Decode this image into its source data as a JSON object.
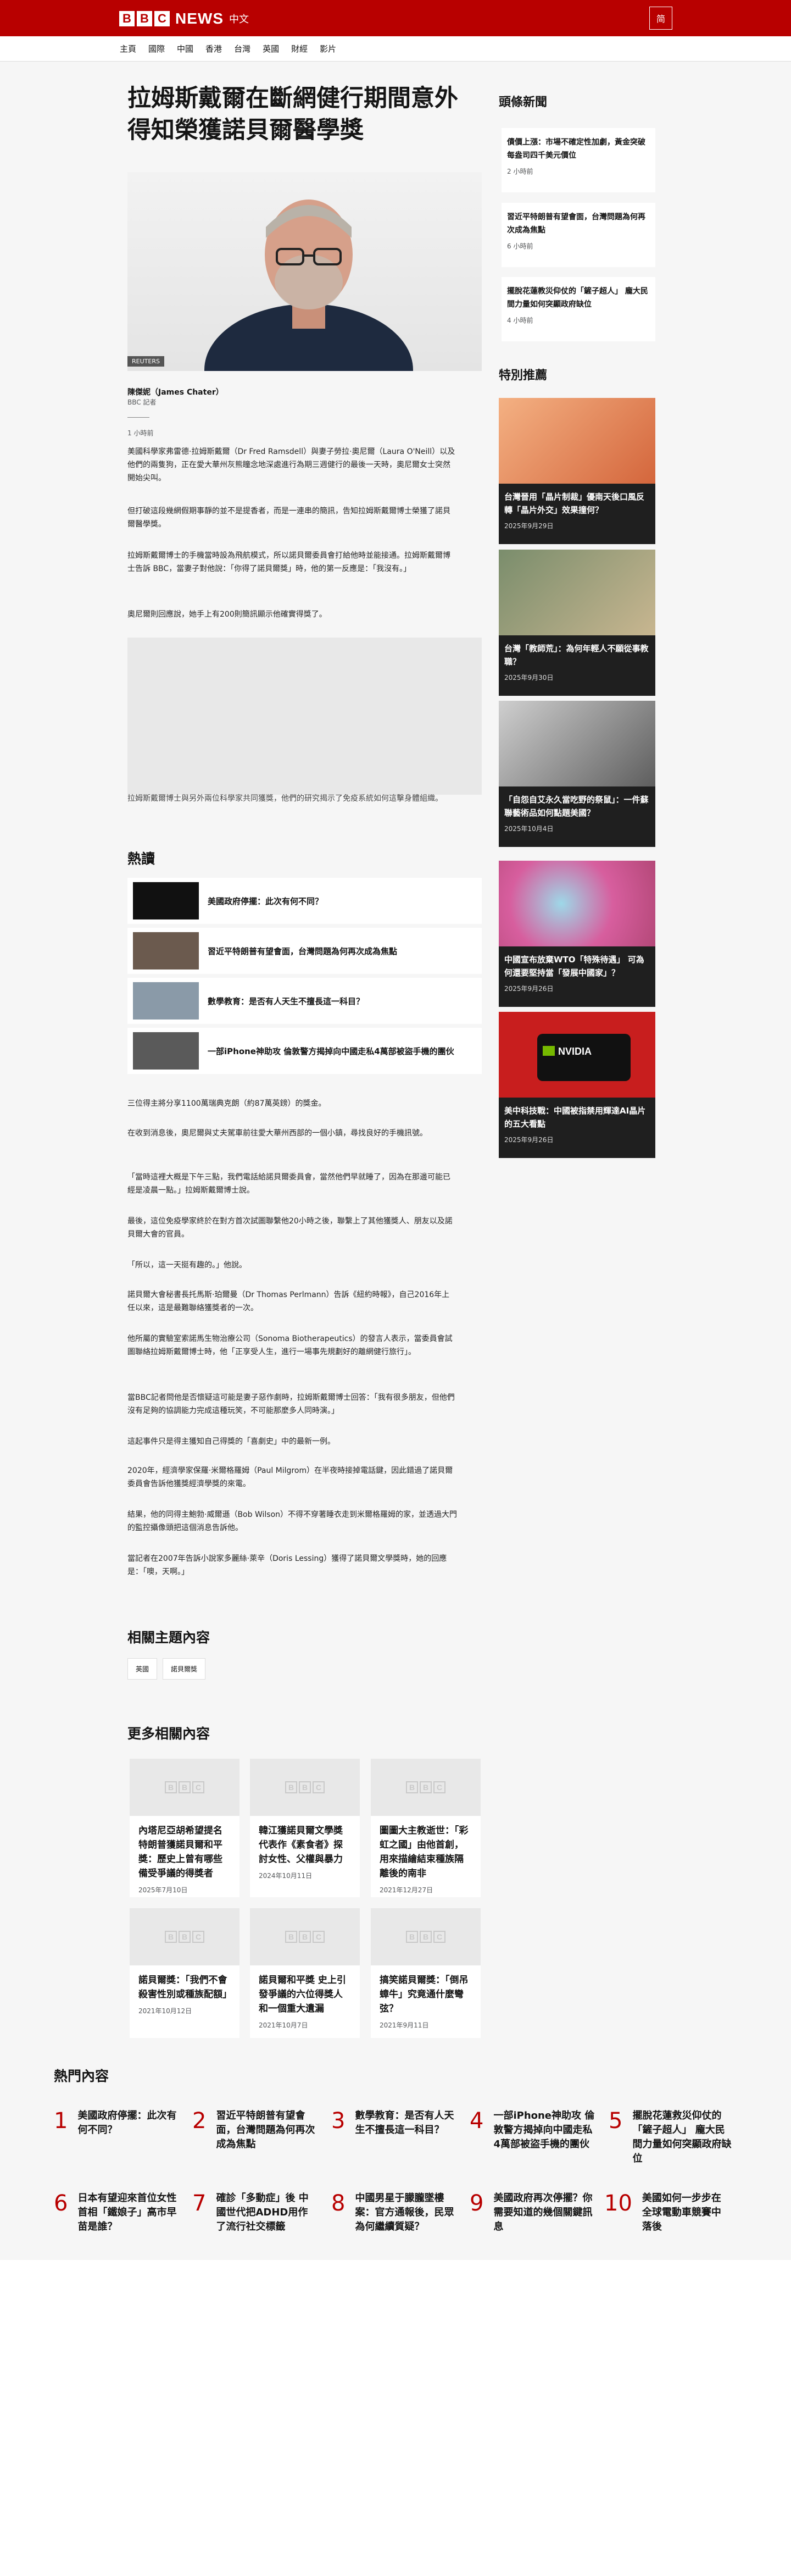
{
  "header": {
    "brand_blocks": [
      "B",
      "B",
      "C"
    ],
    "brand_news": "NEWS",
    "brand_lang": "中文",
    "menu_button": "简"
  },
  "nav": [
    "主頁",
    "國際",
    "中國",
    "香港",
    "台灣",
    "英國",
    "財經",
    "影片"
  ],
  "article": {
    "title": "拉姆斯戴爾在斷網健行期間意外得知榮獲諾貝爾醫學獎",
    "image_credit": "REUTERS",
    "author": "陳傑妮（James Chater）",
    "author_role": "BBC 記者",
    "time": "1 小時前",
    "paragraphs": [
      "美國科學家弗雷德·拉姆斯戴爾（Dr Fred Ramsdell）與妻子勞拉·奧尼爾（Laura O'Neill）以及他們的兩隻狗，正在愛大華州灰熊瞳念地深處進行為期三週健行的最後一天時，奧尼爾女士突然開始尖叫。",
      "但打破這段幾網假期事靜的並不是提香者，而是一連串的簡訊，告知拉姆斯戴爾博士榮獲了諾貝爾醫學獎。",
      "拉姆斯戴爾博士的手機當時設為飛航模式，所以諾貝爾委員會打給他時並能接通。拉姆斯戴爾博士告訴 BBC，當妻子對他說：「你得了諾貝爾獎」時，他的第一反應是：「我沒有。」",
      "奧尼爾則回應說，她手上有200則簡訊顯示他確實得獎了。"
    ],
    "photo_caption": "拉姆斯戴爾博士與另外兩位科學家共同獲獎，他們的研究揭示了免疫系統如何這擊身體組織。",
    "paragraphs2": [
      "三位得主將分享1100萬瑞典克朗（約87萬英鎊）的獎金。",
      "在收到消息後，奧尼爾與丈夫駕車前往愛大華州西部的一個小鎮，尋找良好的手機訊號。",
      "「當時這裡大概是下午三點，我們電話給諾貝爾委員會，當然他們早就睡了，因為在那邊可能已經是凌晨一點。」拉姆斯戴爾博士說。",
      "最後，這位免疫學家終於在對方首次試圖聯繫他20小時之後，聯繫上了其他獲獎人、朋友以及諾貝爾大會的官員。",
      "「所以，這一天挺有趣的。」他說。",
      "諾貝爾大會秘書長托馬斯·珀爾曼（Dr Thomas Perlmann）告訴《紐約時報》，自己2016年上任以來，這是最難聯絡獲獎者的一次。",
      "他所屬的實驗室索諾馬生物治療公司（Sonoma Biotherapeutics）的發言人表示，當委員會試圖聯絡拉姆斯戴爾博士時，他「正享受人生，進行一場事先規劃好的離網健行旅行」。",
      "當BBC記者問他是否懷疑這可能是妻子惡作劇時，拉姆斯戴爾博士回答：「我有很多朋友，但他們沒有足夠的協調能力完成這種玩笑，不可能那麼多人同時演。」",
      "這起事件只是得主獲知自己得獎的「喜劇史」中的最新一例。",
      "2020年，經濟學家保羅·米爾格羅姆（Paul Milgrom）在半夜時接掉電話鍵，因此錯過了諾貝爾委員會告訴他獲獎經濟學獎的來電。",
      "結果，他的同得主鮑勃·威爾遜（Bob Wilson）不得不穿著睡衣走到米爾格羅姆的家，並透過大門的監控攝像頭把這個消息告訴他。",
      "當記者在2007年告訴小說家多麗絲·萊辛（Doris Lessing）獲得了諾貝爾文學獎時，她的回應是：「噢，天啊。」"
    ]
  },
  "hot_section": {
    "title": "熱讀",
    "items": [
      "美國政府停擺：此次有何不同？",
      "習近平特朗普有望會面，台灣問題為何再次成為焦點",
      "數學教育：是否有人天生不擅長這一科目？",
      "一部iPhone神助攻 倫敦警方揭掉向中國走私4萬部被盜手機的團伙"
    ]
  },
  "related_topics": {
    "title": "相關主題內容",
    "tags": [
      "英國",
      "諾貝爾獎"
    ]
  },
  "more_related": {
    "title": "更多相關內容",
    "cards": [
      {
        "title": "內塔尼亞胡希望提名特朗普獲諾貝爾和平獎：歷史上曾有哪些備受爭議的得獎者",
        "date": "2025年7月10日"
      },
      {
        "title": "韓江獲諾貝爾文學獎 代表作《素食者》探討女性、父權與暴力",
        "date": "2024年10月11日"
      },
      {
        "title": "圖圖大主教逝世：「彩虹之國」由他首創，用來描繪結束種族隔離後的南非",
        "date": "2021年12月27日"
      },
      {
        "title": "諾貝爾獎：「我們不會殺害性別或種族配額」",
        "date": "2021年10月12日"
      },
      {
        "title": "諾貝爾和平獎 史上引發爭議的六位得獎人和一個重大遺漏",
        "date": "2021年10月7日"
      },
      {
        "title": "搞笑諾貝爾獎：「倒吊蟑牛」究竟通什麼彎弦？",
        "date": "2021年9月11日"
      }
    ]
  },
  "sidebar": {
    "headlines_title": "頭條新聞",
    "headlines": [
      {
        "title": "債價上漲：市場不確定性加劇，黃金突破每盎司四千美元價位",
        "time": "2 小時前"
      },
      {
        "title": "習近平特朗普有望會面，台灣問題為何再次成為焦點",
        "time": "6 小時前"
      },
      {
        "title": "擺脫花蓮教災仰仗的「鏟子超人」 龐大民間力量如何突顯政府缺位",
        "time": "4 小時前"
      }
    ],
    "recommended_title": "特別推薦",
    "recommended": [
      {
        "title": "台灣晉用「晶片制裁」優南天後口風反轉「晶片外交」效果撞何？",
        "date": "2025年9月29日"
      },
      {
        "title": "台灣「教師荒」：為何年輕人不願從事教職？",
        "date": "2025年9月30日"
      },
      {
        "title": "「自怨自艾永久當吃野的祭鼠」：一件蘇聯藝術品如何點題美國？",
        "date": "2025年10月4日"
      },
      {
        "title": "中國宣布放棄WTO「特殊待遇」 可為何還要堅持當「發展中國家」？",
        "date": "2025年9月26日"
      },
      {
        "title": "美中科技戰：中國被指禁用輝達AI晶片的五大看點",
        "date": "2025年9月26日"
      }
    ]
  },
  "popular": {
    "title": "熱門內容",
    "items": [
      {
        "n": "1",
        "title": "美國政府停擺：此次有何不同？"
      },
      {
        "n": "2",
        "title": "習近平特朗普有望會面，台灣問題為何再次成為焦點"
      },
      {
        "n": "3",
        "title": "數學教育：是否有人天生不擅長這一科目？"
      },
      {
        "n": "4",
        "title": "一部iPhone神助攻 倫敦警方揭掉向中國走私4萬部被盜手機的團伙"
      },
      {
        "n": "5",
        "title": "擺脫花蓮救災仰仗的「鏟子超人」 龐大民間力量如何突顯政府缺位"
      },
      {
        "n": "6",
        "title": "日本有望迎來首位女性首相「鐵娘子」高市早苗是誰？"
      },
      {
        "n": "7",
        "title": "確診「多動症」後 中國世代把ADHD用作了流行社交標籤"
      },
      {
        "n": "8",
        "title": "中國男星于朦朧墜樓案：官方通報後，民眾為何繼續質疑？"
      },
      {
        "n": "9",
        "title": "美國政府再次停擺？你需要知道的幾個關鍵訊息"
      },
      {
        "n": "10",
        "title": "美國如何一步步在全球電動車競賽中落後"
      }
    ]
  }
}
